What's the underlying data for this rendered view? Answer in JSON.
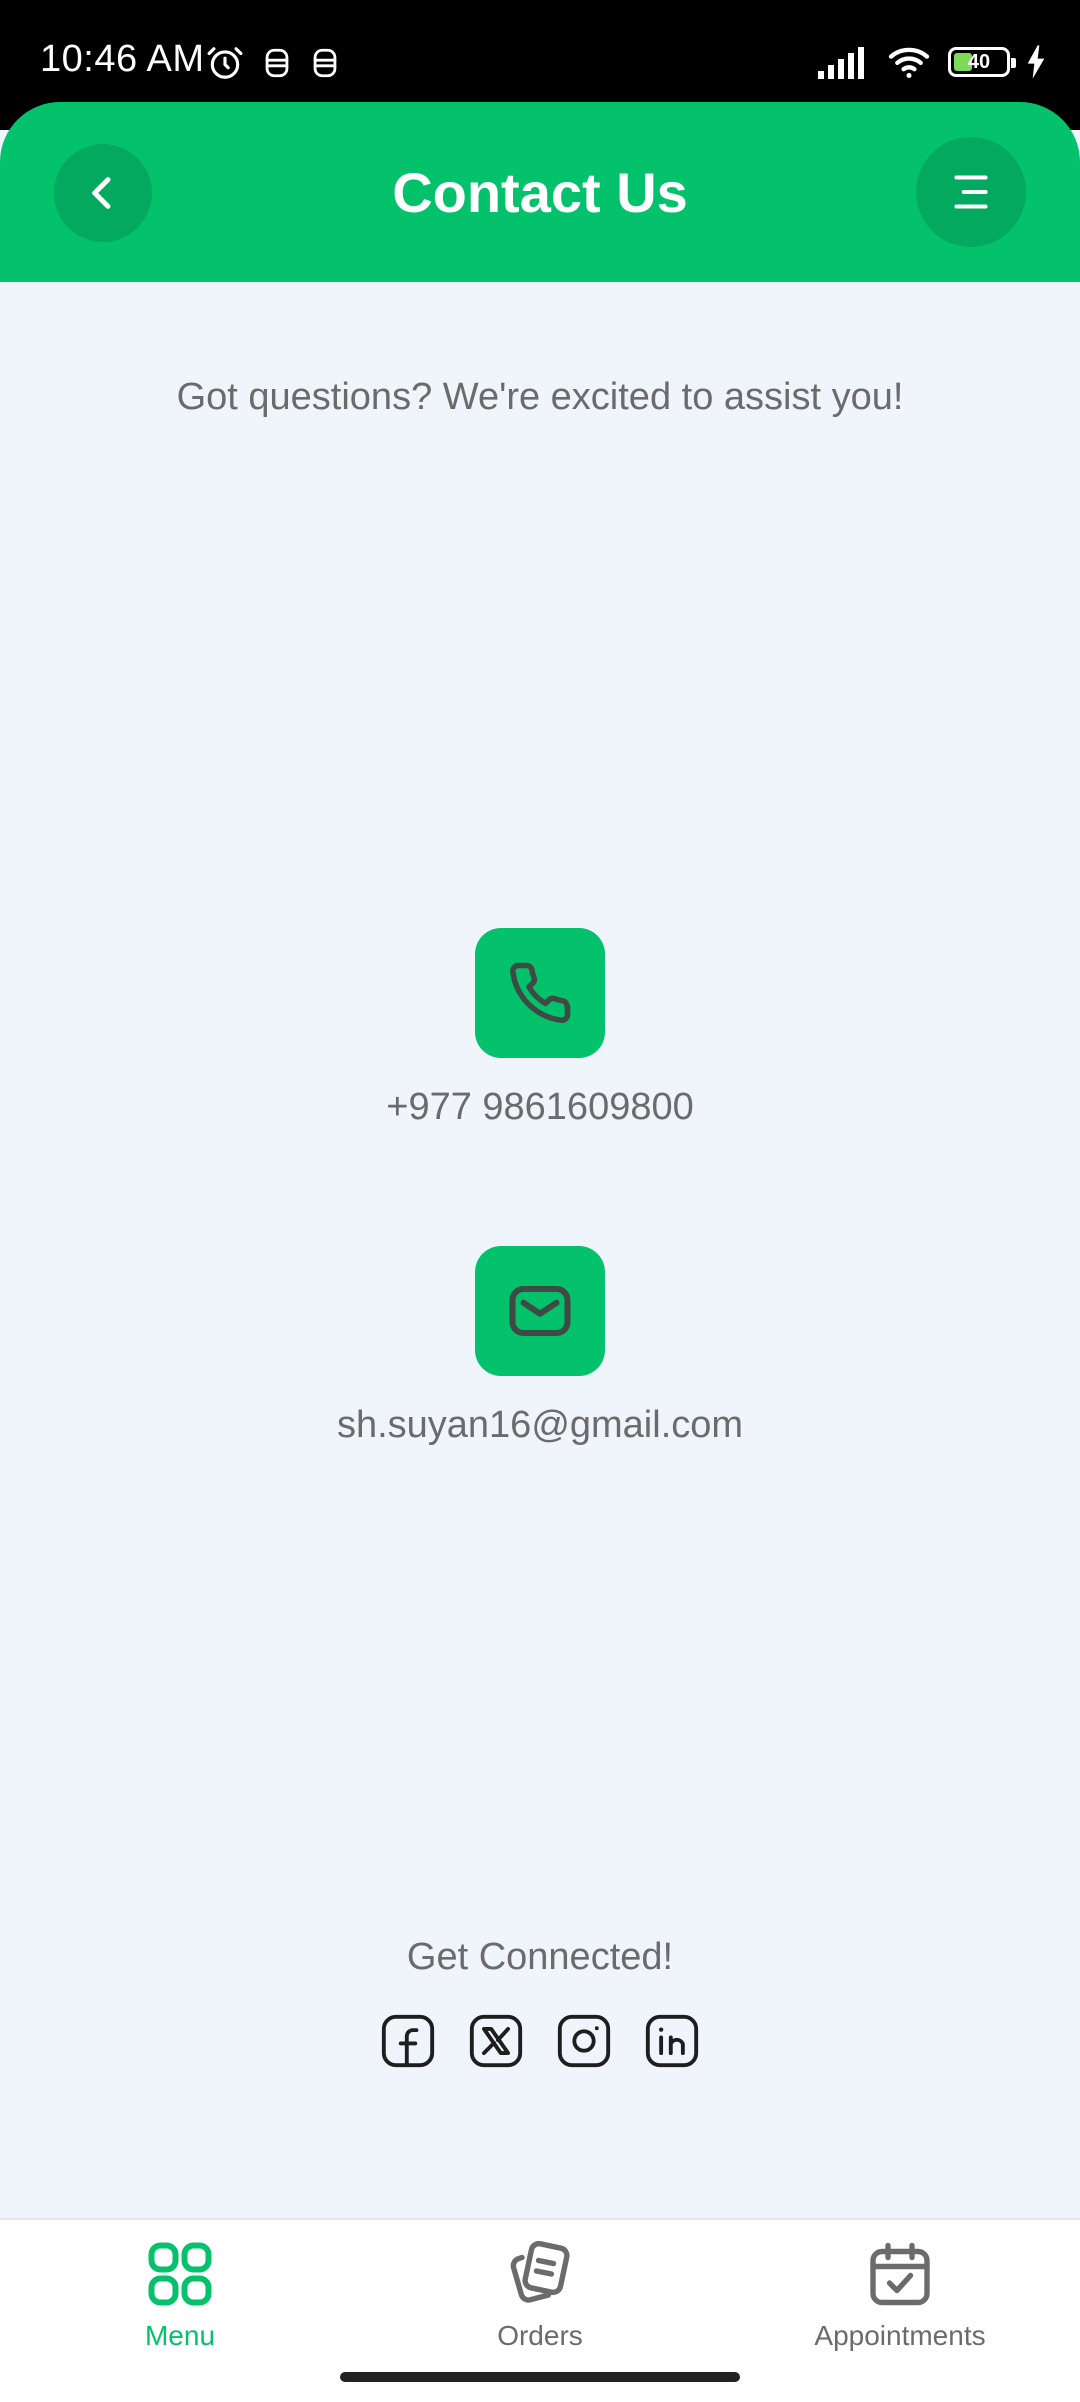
{
  "status_bar": {
    "time": "10:46 AM",
    "battery_level": "40"
  },
  "header": {
    "title": "Contact Us"
  },
  "content": {
    "intro": "Got questions? We're excited to assist you!",
    "phone": "+977 9861609800",
    "email": "sh.suyan16@gmail.com",
    "connected": "Get Connected!"
  },
  "social": [
    "facebook-icon",
    "x-twitter-icon",
    "instagram-icon",
    "linkedin-icon"
  ],
  "bottom_nav": {
    "items": [
      {
        "label": "Menu",
        "icon": "grid-icon",
        "active": true
      },
      {
        "label": "Orders",
        "icon": "orders-icon",
        "active": false
      },
      {
        "label": "Appointments",
        "icon": "calendar-check-icon",
        "active": false
      }
    ]
  },
  "colors": {
    "accent": "#04C16B",
    "accent_dark": "#03A95E",
    "background": "#F0F4FB",
    "text_muted": "#6B6B6B"
  }
}
